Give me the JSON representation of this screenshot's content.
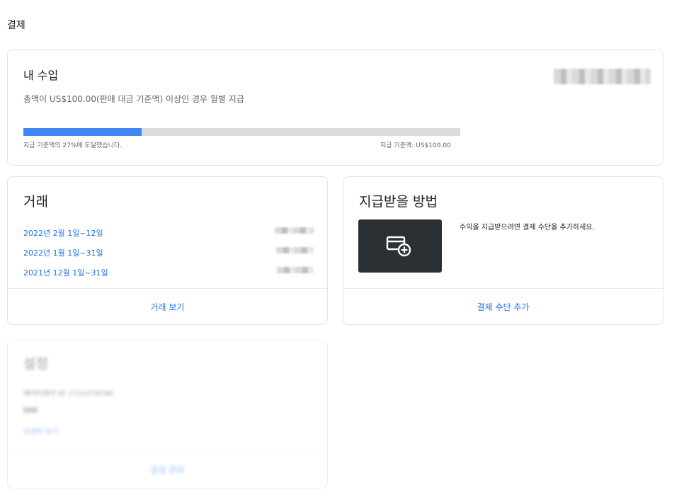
{
  "page": {
    "title": "결제"
  },
  "earnings": {
    "title": "내 수입",
    "subtitle": "총액이 US$100.00(판매 대금 기준액) 이상인 경우 월별 지급",
    "progress_percent": 27,
    "progress_text": "지급 기준액의 27%에 도달했습니다.",
    "threshold_text": "지급 기준액: US$100.00",
    "bar_fill_color": "#4285f4",
    "bar_track_color": "#dadce0"
  },
  "transactions": {
    "title": "거래",
    "items": [
      {
        "label": "2022년 2월 1일~12일"
      },
      {
        "label": "2022년 1월 1일~31일"
      },
      {
        "label": "2021년 12월 1일~31일"
      }
    ],
    "footer_link": "거래 보기"
  },
  "payment_method": {
    "title": "지급받을 방법",
    "description": "수익을 지급받으려면 결제 수단을 추가하세요.",
    "icon": "add-card-icon",
    "footer_link": "결제 수단 추가"
  },
  "settings": {
    "title": "설정",
    "lines": [
      "데이터관리 ID 1711579740"
    ],
    "link": "자세히 보기",
    "footer_link": "설정 관리"
  }
}
